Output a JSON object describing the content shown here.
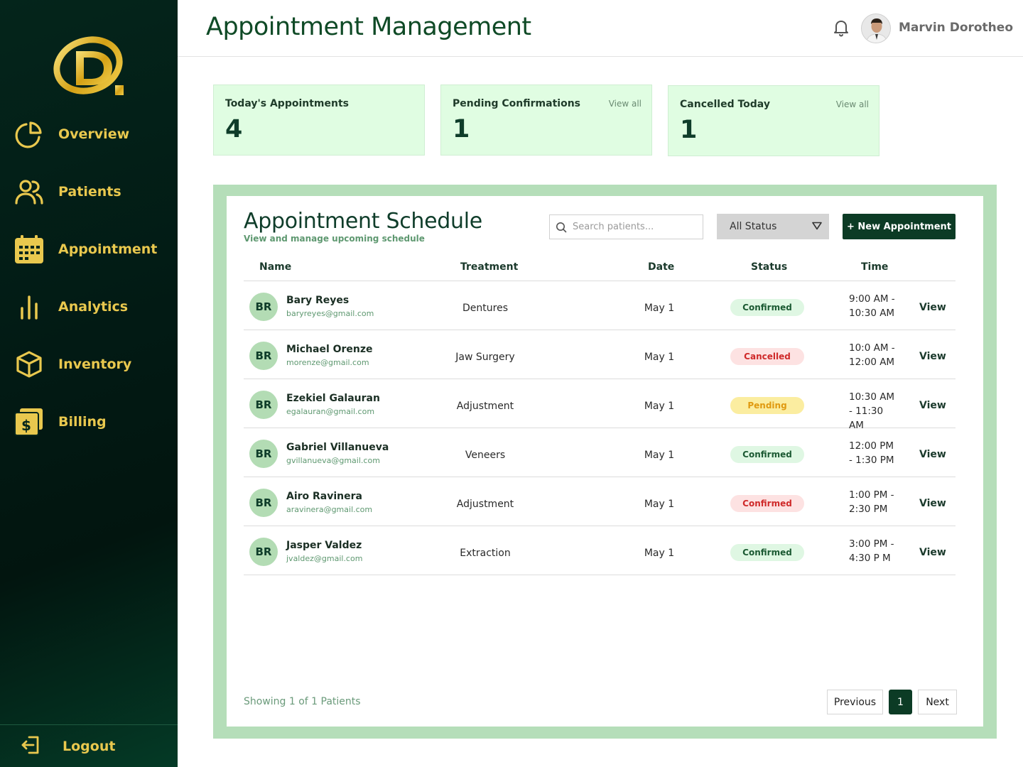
{
  "sidebar": {
    "items": [
      {
        "label": "Overview",
        "icon": "pie-chart-icon"
      },
      {
        "label": "Patients",
        "icon": "users-icon"
      },
      {
        "label": "Appointment",
        "icon": "calendar-icon"
      },
      {
        "label": "Analytics",
        "icon": "bar-chart-icon"
      },
      {
        "label": "Inventory",
        "icon": "box-icon"
      },
      {
        "label": "Billing",
        "icon": "billing-icon"
      }
    ],
    "logout_label": "Logout"
  },
  "header": {
    "title": "Appointment Management",
    "user_name": "Marvin Dorotheo"
  },
  "stats": [
    {
      "label": "Today's Appointments",
      "value": "4",
      "link": ""
    },
    {
      "label": "Pending Confirmations",
      "value": "1",
      "link": "View all"
    },
    {
      "label": "Cancelled Today",
      "value": "1",
      "link": "View all"
    }
  ],
  "schedule": {
    "title": "Appointment Schedule",
    "subtitle": "View and manage upcoming schedule",
    "search_placeholder": "Search patients...",
    "status_filter": "All Status",
    "new_button": "+ New Appointment",
    "columns": {
      "name": "Name",
      "treatment": "Treatment",
      "date": "Date",
      "status": "Status",
      "time": "Time"
    },
    "rows": [
      {
        "initials": "BR",
        "name": "Bary Reyes",
        "email": "baryreyes@gmail.com",
        "treatment": "Dentures",
        "date": "May 1",
        "status": "Confirmed",
        "status_color": "green",
        "time": "9:00 AM - 10:30 AM",
        "action": "View"
      },
      {
        "initials": "BR",
        "name": "Michael Orenze",
        "email": "morenze@gmail.com",
        "treatment": "Jaw Surgery",
        "date": "May 1",
        "status": "Cancelled",
        "status_color": "red",
        "time": "10:0 AM - 12:00 AM",
        "action": "View"
      },
      {
        "initials": "BR",
        "name": "Ezekiel Galauran",
        "email": "egalauran@gmail.com",
        "treatment": "Adjustment",
        "date": "May 1",
        "status": "Pending",
        "status_color": "yellow",
        "time": "10:30 AM - 11:30 AM",
        "action": "View"
      },
      {
        "initials": "BR",
        "name": "Gabriel Villanueva",
        "email": "gvillanueva@gmail.com",
        "treatment": "Veneers",
        "date": "May 1",
        "status": "Confirmed",
        "status_color": "green",
        "time": "12:00 PM - 1:30 PM",
        "action": "View"
      },
      {
        "initials": "BR",
        "name": "Airo Ravinera",
        "email": "aravinera@gmail.com",
        "treatment": "Adjustment",
        "date": "May 1",
        "status": "Confirmed",
        "status_color": "red",
        "time": "1:00 PM - 2:30 PM",
        "action": "View"
      },
      {
        "initials": "BR",
        "name": "Jasper Valdez",
        "email": "jvaldez@gmail.com",
        "treatment": "Extraction",
        "date": "May 1",
        "status": "Confirmed",
        "status_color": "green",
        "time": "3:00 PM - 4:30 P M",
        "action": "View"
      }
    ],
    "showing_text": "Showing 1 of 1 Patients",
    "pagination": {
      "previous": "Previous",
      "current": "1",
      "next": "Next"
    }
  },
  "colors": {
    "sidebar_bg": "#02150f",
    "accent_gold": "#e9c84e",
    "primary_green": "#0c3b25",
    "card_bg": "#e0fde2",
    "frame_bg": "#b5deb9"
  }
}
